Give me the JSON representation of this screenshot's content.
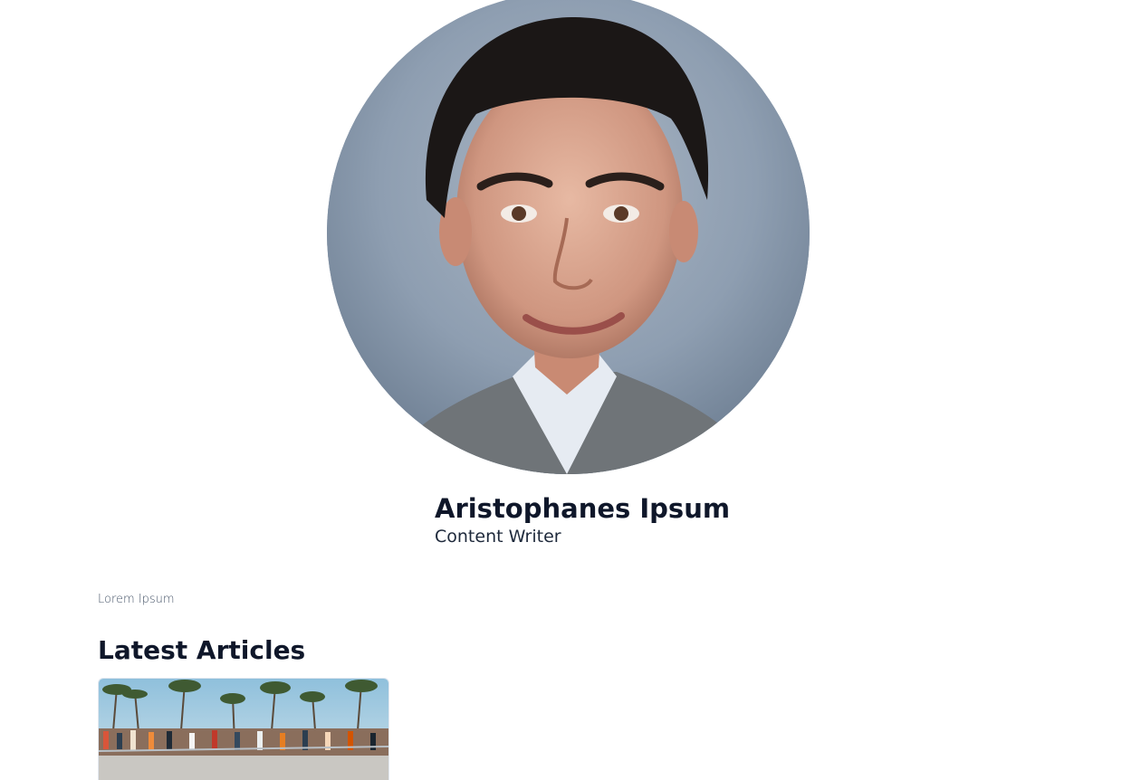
{
  "author": {
    "name": "Aristophanes Ipsum",
    "role": "Content Writer",
    "bio": "Lorem Ipsum"
  },
  "articles_section": {
    "title": "Latest Articles"
  },
  "colors": {
    "text_primary": "#0f172a",
    "text_muted": "#475569",
    "avatar_background": "#8c9caf"
  },
  "icons": {
    "avatar": "author-portrait-photo",
    "article_thumbnail": "beach-boardwalk-photo"
  }
}
